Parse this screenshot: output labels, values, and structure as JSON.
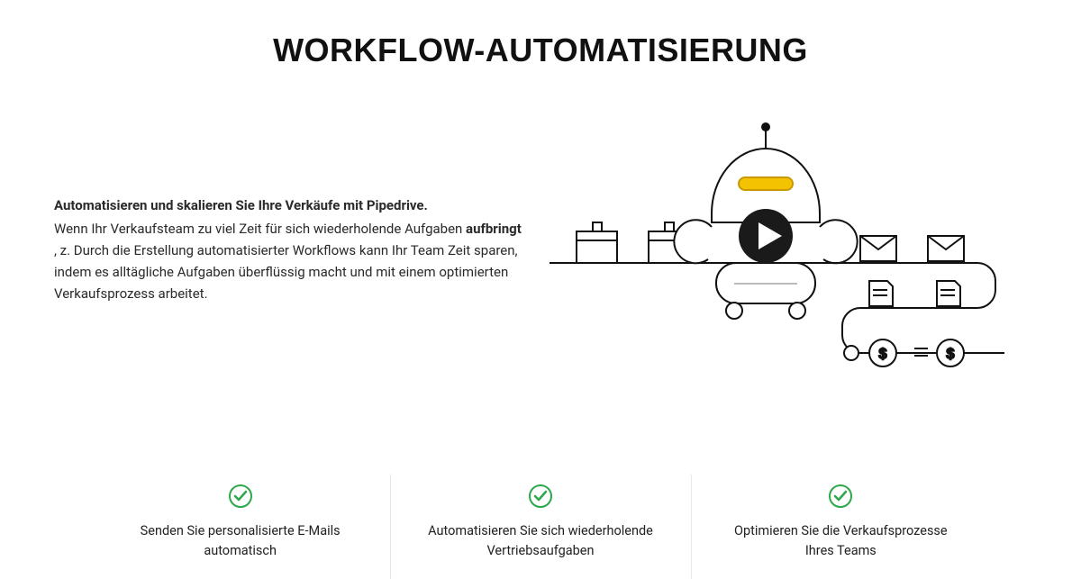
{
  "title": "WORKFLOW-AUTOMATISIERUNG",
  "hero": {
    "lead": "Automatisieren und skalieren Sie Ihre Verkäufe mit Pipedrive.",
    "body_pre": "Wenn Ihr Verkaufsteam zu viel Zeit für sich wiederholende Aufgaben ",
    "bold": "aufbringt",
    "body_post": " , z. Durch die Erstellung automatisierter Workflows kann Ihr Team Zeit sparen, indem es alltägliche Aufgaben überflüssig macht und mit einem optimierten Verkaufsprozess arbeitet."
  },
  "benefits": [
    {
      "label": "Senden Sie personalisierte E-Mails automatisch"
    },
    {
      "label": "Automatisieren Sie sich wiederholende Vertriebsaufgaben"
    },
    {
      "label": "Optimieren Sie die Verkaufsprozesse Ihres Teams"
    }
  ],
  "colors": {
    "accent_green": "#2ca84a",
    "accent_yellow": "#f3c200",
    "play_bg": "#1a1a1a"
  }
}
